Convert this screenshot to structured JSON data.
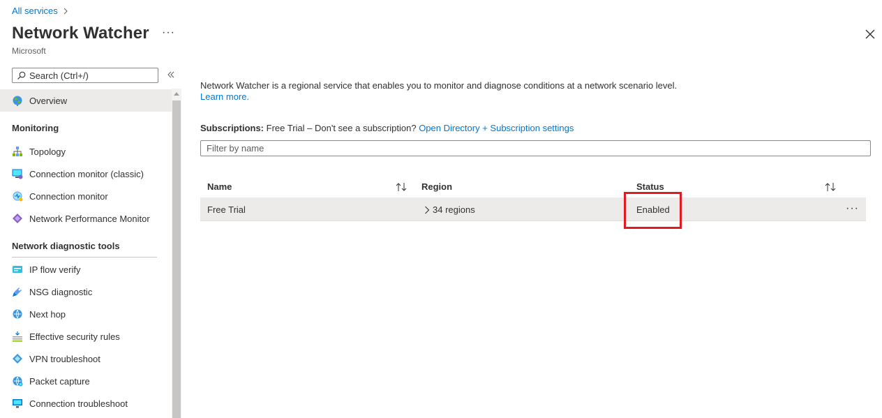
{
  "breadcrumb": {
    "root": "All services"
  },
  "header": {
    "title": "Network Watcher",
    "subtitle": "Microsoft",
    "more": "···"
  },
  "search": {
    "placeholder": "Search (Ctrl+/)"
  },
  "sidebar": {
    "overview": {
      "label": "Overview",
      "icon": "globe-icon"
    },
    "sections": [
      {
        "title": "Monitoring",
        "items": [
          {
            "label": "Topology",
            "icon": "topology-icon"
          },
          {
            "label": "Connection monitor (classic)",
            "icon": "monitor-icon"
          },
          {
            "label": "Connection monitor",
            "icon": "connection-monitor-icon"
          },
          {
            "label": "Network Performance Monitor",
            "icon": "diamond-icon"
          }
        ]
      },
      {
        "title": "Network diagnostic tools",
        "items": [
          {
            "label": "IP flow verify",
            "icon": "ip-flow-icon"
          },
          {
            "label": "NSG diagnostic",
            "icon": "nsg-diagnostic-icon"
          },
          {
            "label": "Next hop",
            "icon": "next-hop-icon"
          },
          {
            "label": "Effective security rules",
            "icon": "security-rules-icon"
          },
          {
            "label": "VPN troubleshoot",
            "icon": "vpn-icon"
          },
          {
            "label": "Packet capture",
            "icon": "packet-capture-icon"
          },
          {
            "label": "Connection troubleshoot",
            "icon": "connection-troubleshoot-icon"
          }
        ]
      }
    ]
  },
  "main": {
    "description": "Network Watcher is a regional service that enables you to monitor and diagnose conditions at a network scenario level.",
    "learn_more": "Learn more.",
    "subscriptions": {
      "label": "Subscriptions:",
      "value": "Free Trial",
      "prompt": " – Don't see a subscription? ",
      "link": "Open Directory + Subscription settings"
    },
    "filter": {
      "placeholder": "Filter by name"
    },
    "table": {
      "columns": [
        "Name",
        "Region",
        "Status"
      ],
      "rows": [
        {
          "name": "Free Trial",
          "region": "34 regions",
          "status": "Enabled"
        }
      ]
    }
  },
  "colors": {
    "link": "#0078d4",
    "highlight": "#e01b24",
    "selected_bg": "#edebe9"
  }
}
